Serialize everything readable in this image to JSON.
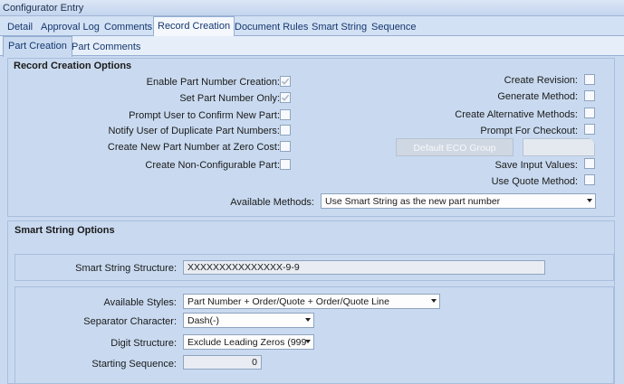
{
  "window": {
    "title": "Configurator Entry"
  },
  "tabs": [
    {
      "label": "Detail"
    },
    {
      "label": "Approval Log"
    },
    {
      "label": "Comments"
    },
    {
      "label": "Record Creation"
    },
    {
      "label": "Document Rules"
    },
    {
      "label": "Smart String"
    },
    {
      "label": "Sequence"
    }
  ],
  "subtabs": [
    {
      "label": "Part Creation"
    },
    {
      "label": "Part Comments"
    }
  ],
  "record_creation": {
    "title": "Record Creation Options",
    "left_options": [
      {
        "label": "Enable Part Number Creation:",
        "checked": true,
        "disabled": true
      },
      {
        "label": "Set Part Number Only:",
        "checked": true,
        "disabled": true
      },
      {
        "label": "Prompt User to Confirm New Part:",
        "checked": false,
        "disabled": false
      },
      {
        "label": "Notify User of Duplicate Part Numbers:",
        "checked": false,
        "disabled": false
      },
      {
        "label": "Create New Part Number at Zero Cost:",
        "checked": false,
        "disabled": false
      },
      {
        "label": "Create Non-Configurable Part:",
        "checked": false,
        "disabled": false
      }
    ],
    "right_options": [
      {
        "label": "Create Revision:",
        "checked": false
      },
      {
        "label": "Generate Method:",
        "checked": false
      },
      {
        "label": "Create Alternative Methods:",
        "checked": false
      },
      {
        "label": "Prompt For Checkout:",
        "checked": false
      }
    ],
    "default_eco_group": {
      "button_label": "Default ECO Group",
      "value": ""
    },
    "right_options_2": [
      {
        "label": "Save Input Values:",
        "checked": false
      },
      {
        "label": "Use Quote Method:",
        "checked": false
      }
    ],
    "available_methods": {
      "label": "Available Methods:",
      "value": "Use Smart String as the new part number"
    }
  },
  "smart_string": {
    "title": "Smart String Options",
    "structure": {
      "label": "Smart String Structure:",
      "value": "XXXXXXXXXXXXXXX-9-9"
    },
    "available_styles": {
      "label": "Available Styles:",
      "value": "Part Number + Order/Quote + Order/Quote Line"
    },
    "separator": {
      "label": "Separator Character:",
      "value": "Dash(-)"
    },
    "digit_structure": {
      "label": "Digit Structure:",
      "value": "Exclude Leading Zeros (999"
    },
    "starting_sequence": {
      "label": "Starting Sequence:",
      "value": "0"
    }
  },
  "colors": {
    "background": "#c9daf0",
    "tab_active": "#f4f8fd",
    "tab_text": "#15376e",
    "check_disabled": "#a9b4c4"
  }
}
